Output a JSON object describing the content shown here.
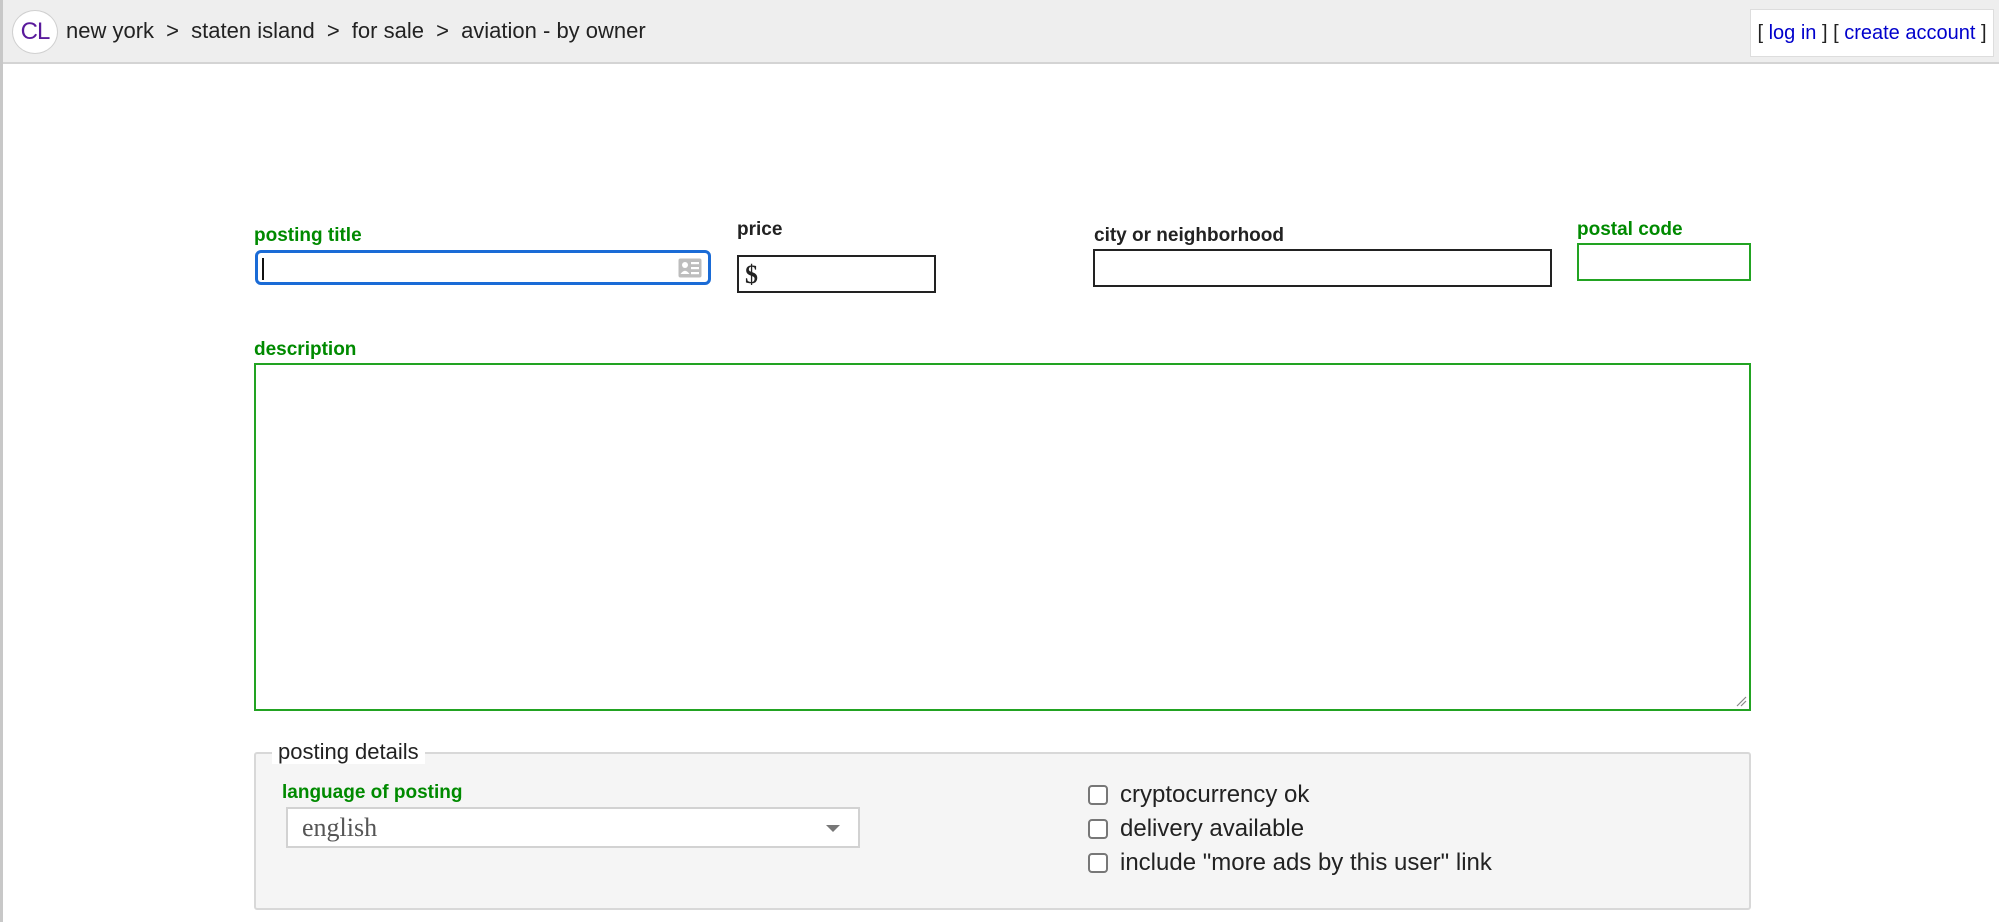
{
  "header": {
    "logo_text": "CL",
    "breadcrumb": [
      {
        "label": "new york"
      },
      {
        "label": "staten island"
      },
      {
        "label": "for sale"
      },
      {
        "label": "aviation - by owner"
      }
    ],
    "breadcrumb_separator": ">",
    "account": {
      "open_bracket": "[",
      "close_bracket": "]",
      "login_label": "log in",
      "create_account_label": "create account"
    }
  },
  "form": {
    "posting_title": {
      "label": "posting title",
      "value": "",
      "focused": true
    },
    "price": {
      "label": "price",
      "currency_symbol": "$",
      "value": ""
    },
    "city": {
      "label": "city or neighborhood",
      "value": ""
    },
    "postal_code": {
      "label": "postal code",
      "value": ""
    },
    "description": {
      "label": "description",
      "value": ""
    }
  },
  "posting_details": {
    "legend": "posting details",
    "language": {
      "label": "language of posting",
      "selected": "english"
    },
    "checkboxes": [
      {
        "label": "cryptocurrency ok",
        "checked": false
      },
      {
        "label": "delivery available",
        "checked": false
      },
      {
        "label": "include \"more ads by this user\" link",
        "checked": false
      }
    ]
  },
  "colors": {
    "required_label": "#008a00",
    "focus_border": "#1a6bd6",
    "link": "#0000cc",
    "logo": "#5a1a9c"
  },
  "icons": {
    "title_field_icon": "contact-card-icon",
    "select_arrow": "chevron-down-icon",
    "textarea_resize": "resize-handle-icon"
  }
}
